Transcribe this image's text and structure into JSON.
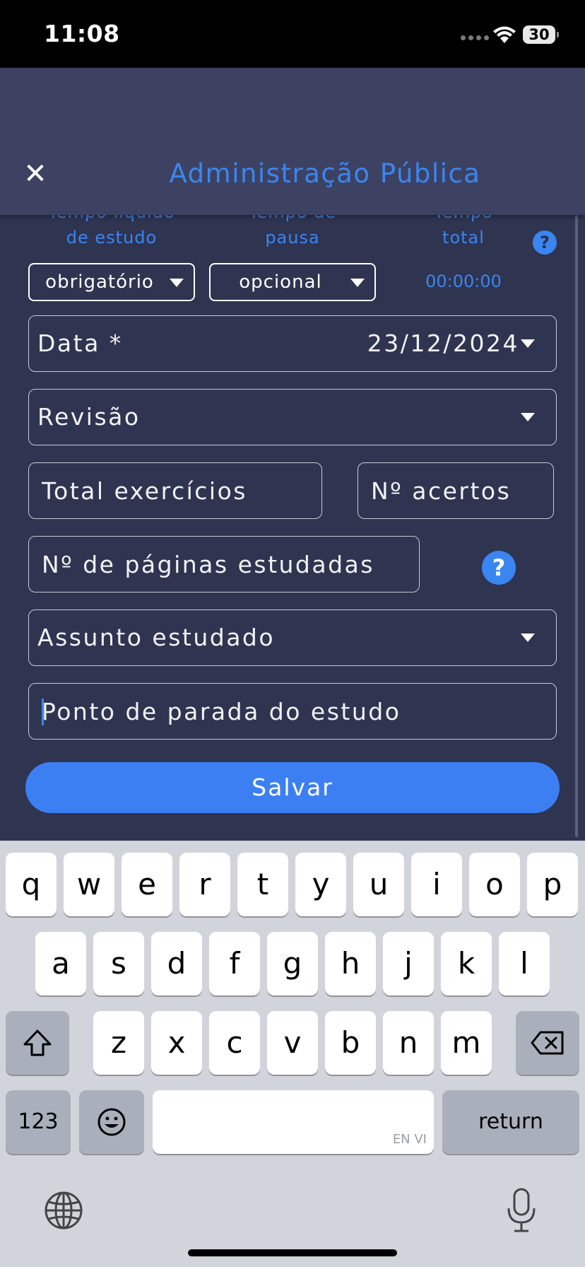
{
  "status_bar": {
    "time": "11:08",
    "battery": "30",
    "icons": [
      "signal-dots-icon",
      "wifi-icon",
      "battery-icon"
    ]
  },
  "header": {
    "title": "Administração Pública",
    "close_icon": "close-icon"
  },
  "timer": {
    "labels": {
      "net_study": [
        "Tempo líquido",
        "de estudo"
      ],
      "pause": [
        "Tempo de",
        "pausa"
      ],
      "total": [
        "Tempo",
        "total"
      ]
    },
    "net_study_button": "obrigatório",
    "pause_button": "opcional",
    "total_value": "00:00:00",
    "help": "?"
  },
  "form": {
    "date": {
      "label": "Data *",
      "value": "23/12/2024"
    },
    "review": {
      "label": "Revisão"
    },
    "total_exercises": {
      "placeholder": "Total exercícios"
    },
    "correct_answers": {
      "placeholder": "Nº acertos"
    },
    "pages_studied": {
      "placeholder": "Nº de páginas estudadas",
      "help": "?"
    },
    "subject": {
      "label": "Assunto estudado"
    },
    "stop_point": {
      "placeholder": "Ponto de parada do estudo"
    },
    "save_label": "Salvar"
  },
  "keyboard": {
    "row1": [
      "q",
      "w",
      "e",
      "r",
      "t",
      "y",
      "u",
      "i",
      "o",
      "p"
    ],
    "row2": [
      "a",
      "s",
      "d",
      "f",
      "g",
      "h",
      "j",
      "k",
      "l"
    ],
    "row3": [
      "z",
      "x",
      "c",
      "v",
      "b",
      "n",
      "m"
    ],
    "numbers_label": "123",
    "space_hint": "EN VI",
    "return_label": "return",
    "icons": [
      "shift-icon",
      "backspace-icon",
      "emoji-icon",
      "globe-icon",
      "microphone-icon"
    ]
  },
  "colors": {
    "accent": "#3a86f0",
    "background": "#2f3451",
    "header": "#3d4263",
    "save": "#3b7ff3"
  }
}
